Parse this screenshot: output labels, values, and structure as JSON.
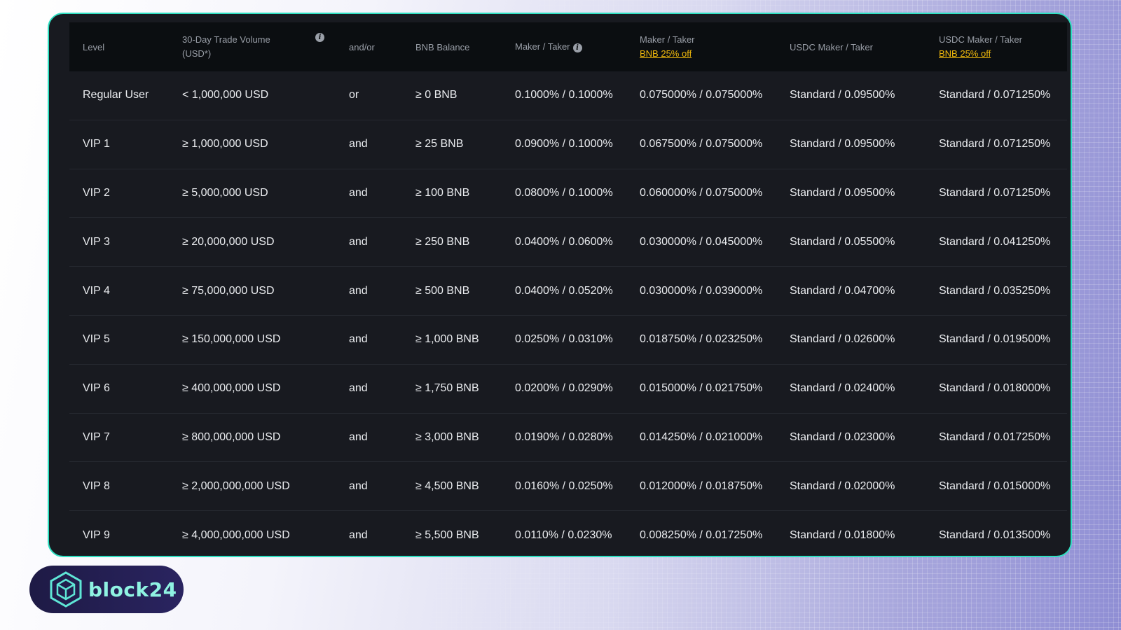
{
  "header": {
    "level": "Level",
    "volume_line1": "30-Day Trade Volume",
    "volume_line2": "(USD*)",
    "andor": "and/or",
    "bnb_balance": "BNB Balance",
    "maker_taker": "Maker / Taker",
    "maker_taker_bnb": "Maker / Taker",
    "maker_taker_bnb_promo": "BNB 25% off",
    "usdc_maker_taker": "USDC Maker / Taker",
    "usdc_maker_taker_bnb": "USDC Maker / Taker",
    "usdc_maker_taker_bnb_promo": "BNB 25% off"
  },
  "rows": [
    {
      "level": "Regular User",
      "volume": "< 1,000,000 USD",
      "andor": "or",
      "bnb": "≥ 0 BNB",
      "mt": "0.1000% / 0.1000%",
      "mt_bnb": "0.075000% / 0.075000%",
      "usdc": "Standard / 0.09500%",
      "usdc_bnb": "Standard / 0.071250%"
    },
    {
      "level": "VIP 1",
      "volume": "≥ 1,000,000 USD",
      "andor": "and",
      "bnb": "≥ 25 BNB",
      "mt": "0.0900% / 0.1000%",
      "mt_bnb": "0.067500% / 0.075000%",
      "usdc": "Standard / 0.09500%",
      "usdc_bnb": "Standard / 0.071250%"
    },
    {
      "level": "VIP 2",
      "volume": "≥ 5,000,000 USD",
      "andor": "and",
      "bnb": "≥ 100 BNB",
      "mt": "0.0800% / 0.1000%",
      "mt_bnb": "0.060000% / 0.075000%",
      "usdc": "Standard / 0.09500%",
      "usdc_bnb": "Standard / 0.071250%"
    },
    {
      "level": "VIP 3",
      "volume": "≥ 20,000,000 USD",
      "andor": "and",
      "bnb": "≥ 250 BNB",
      "mt": "0.0400% / 0.0600%",
      "mt_bnb": "0.030000% / 0.045000%",
      "usdc": "Standard / 0.05500%",
      "usdc_bnb": "Standard / 0.041250%"
    },
    {
      "level": "VIP 4",
      "volume": "≥ 75,000,000 USD",
      "andor": "and",
      "bnb": "≥ 500 BNB",
      "mt": "0.0400% / 0.0520%",
      "mt_bnb": "0.030000% / 0.039000%",
      "usdc": "Standard / 0.04700%",
      "usdc_bnb": "Standard / 0.035250%"
    },
    {
      "level": "VIP 5",
      "volume": "≥ 150,000,000 USD",
      "andor": "and",
      "bnb": "≥ 1,000 BNB",
      "mt": "0.0250% / 0.0310%",
      "mt_bnb": "0.018750% / 0.023250%",
      "usdc": "Standard / 0.02600%",
      "usdc_bnb": "Standard / 0.019500%"
    },
    {
      "level": "VIP 6",
      "volume": "≥ 400,000,000 USD",
      "andor": "and",
      "bnb": "≥ 1,750 BNB",
      "mt": "0.0200% / 0.0290%",
      "mt_bnb": "0.015000% / 0.021750%",
      "usdc": "Standard / 0.02400%",
      "usdc_bnb": "Standard / 0.018000%"
    },
    {
      "level": "VIP 7",
      "volume": "≥ 800,000,000 USD",
      "andor": "and",
      "bnb": "≥ 3,000 BNB",
      "mt": "0.0190% / 0.0280%",
      "mt_bnb": "0.014250% / 0.021000%",
      "usdc": "Standard / 0.02300%",
      "usdc_bnb": "Standard / 0.017250%"
    },
    {
      "level": "VIP 8",
      "volume": "≥ 2,000,000,000 USD",
      "andor": "and",
      "bnb": "≥ 4,500 BNB",
      "mt": "0.0160% / 0.0250%",
      "mt_bnb": "0.012000% / 0.018750%",
      "usdc": "Standard / 0.02000%",
      "usdc_bnb": "Standard / 0.015000%"
    },
    {
      "level": "VIP 9",
      "volume": "≥ 4,000,000,000 USD",
      "andor": "and",
      "bnb": "≥ 5,500 BNB",
      "mt": "0.0110% / 0.0230%",
      "mt_bnb": "0.008250% / 0.017250%",
      "usdc": "Standard / 0.01800%",
      "usdc_bnb": "Standard / 0.013500%"
    }
  ],
  "logo": {
    "text": "block24"
  },
  "colors": {
    "accent_border": "#2fe0c2",
    "promo": "#f0b90b",
    "panel_bg": "#181a20",
    "header_bg": "#0b0e11"
  },
  "icons": {
    "header_info": "info-icon",
    "logo_mark": "hexagon-cube-icon"
  }
}
